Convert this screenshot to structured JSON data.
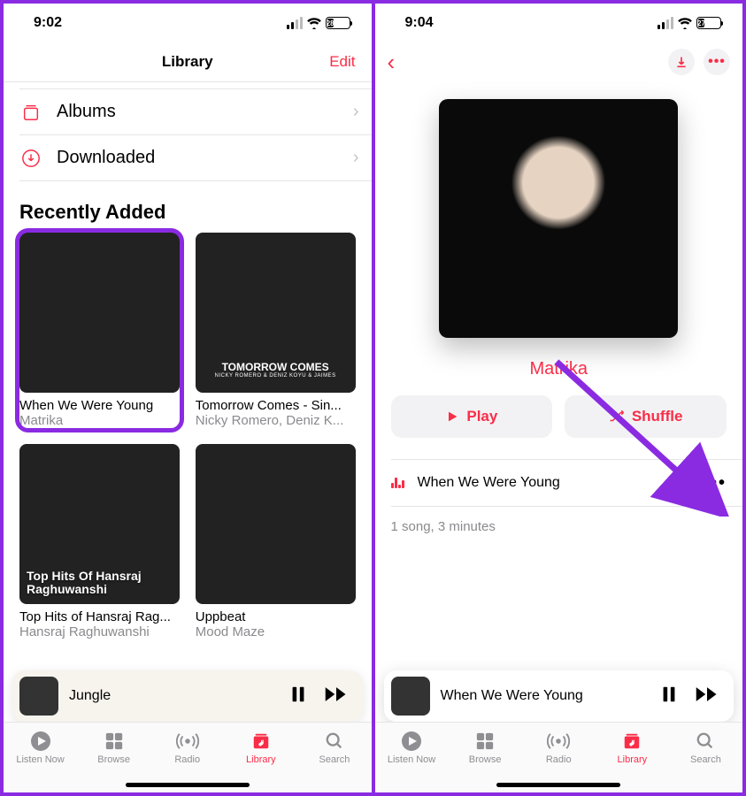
{
  "leftPhone": {
    "status": {
      "time": "9:02",
      "battery": "28"
    },
    "header": {
      "title": "Library",
      "edit": "Edit"
    },
    "menu": {
      "albums": "Albums",
      "downloaded": "Downloaded"
    },
    "section": "Recently Added",
    "albums": [
      {
        "title": "When We Were Young",
        "artist": "Matrika"
      },
      {
        "title": "Tomorrow Comes - Sin...",
        "artist": "Nicky Romero, Deniz K...",
        "coverText": "TOMORROW COMES",
        "coverSub": "NICKY ROMERO & DENIZ KOYU & JAIMES"
      },
      {
        "title": "Top Hits of Hansraj Rag...",
        "artist": "Hansraj Raghuwanshi",
        "coverText": "Top Hits Of Hansraj Raghuwanshi"
      },
      {
        "title": "Uppbeat",
        "artist": "Mood Maze"
      }
    ],
    "nowPlaying": {
      "song": "Jungle"
    },
    "tabs": {
      "listenNow": "Listen Now",
      "browse": "Browse",
      "radio": "Radio",
      "library": "Library",
      "search": "Search"
    }
  },
  "rightPhone": {
    "status": {
      "time": "9:04",
      "battery": "27"
    },
    "artist": "Matrika",
    "buttons": {
      "play": "Play",
      "shuffle": "Shuffle"
    },
    "song": "When We Were Young",
    "summary": "1 song, 3 minutes",
    "nowPlaying": {
      "song": "When We Were Young"
    },
    "tabs": {
      "listenNow": "Listen Now",
      "browse": "Browse",
      "radio": "Radio",
      "library": "Library",
      "search": "Search"
    }
  }
}
